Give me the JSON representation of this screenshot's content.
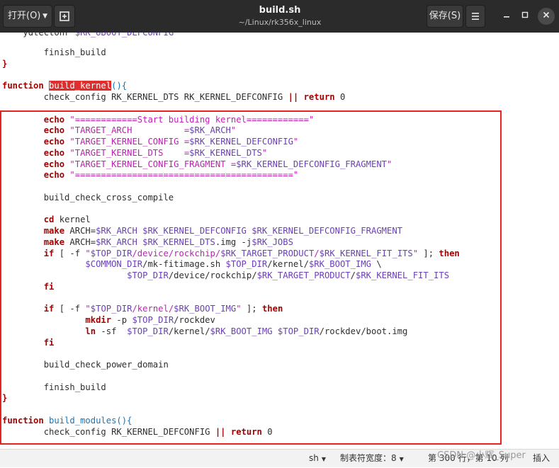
{
  "header": {
    "open_label": "打开(O)",
    "title": "build.sh",
    "subtitle": "~/Linux/rk356x_linux",
    "save_label": "保存(S)"
  },
  "code_lines": [
    [
      {
        "t": "        finish_build",
        "c": ""
      }
    ],
    [
      {
        "t": "}",
        "c": "kw"
      }
    ],
    [],
    [
      {
        "t": "function",
        "c": "kw"
      },
      {
        "t": " ",
        "c": ""
      },
      {
        "t": "build_kernel",
        "c": "hl"
      },
      {
        "t": "(){",
        "c": "fn"
      }
    ],
    [
      {
        "t": "        check_config RK_KERNEL_DTS RK_KERNEL_DEFCONFIG ",
        "c": ""
      },
      {
        "t": "||",
        "c": "kw"
      },
      {
        "t": " ",
        "c": ""
      },
      {
        "t": "return",
        "c": "kw"
      },
      {
        "t": " 0",
        "c": ""
      }
    ],
    [],
    [
      {
        "t": "        ",
        "c": ""
      },
      {
        "t": "echo",
        "c": "kw"
      },
      {
        "t": " \"============Start building kernel============\"",
        "c": "st"
      }
    ],
    [
      {
        "t": "        ",
        "c": ""
      },
      {
        "t": "echo",
        "c": "kw"
      },
      {
        "t": " \"TARGET_ARCH          =",
        "c": "st"
      },
      {
        "t": "$RK_ARCH",
        "c": "vr"
      },
      {
        "t": "\"",
        "c": "st"
      }
    ],
    [
      {
        "t": "        ",
        "c": ""
      },
      {
        "t": "echo",
        "c": "kw"
      },
      {
        "t": " \"TARGET_KERNEL_CONFIG =",
        "c": "st"
      },
      {
        "t": "$RK_KERNEL_DEFCONFIG",
        "c": "vr"
      },
      {
        "t": "\"",
        "c": "st"
      }
    ],
    [
      {
        "t": "        ",
        "c": ""
      },
      {
        "t": "echo",
        "c": "kw"
      },
      {
        "t": " \"TARGET_KERNEL_DTS    =",
        "c": "st"
      },
      {
        "t": "$RK_KERNEL_DTS",
        "c": "vr"
      },
      {
        "t": "\"",
        "c": "st"
      }
    ],
    [
      {
        "t": "        ",
        "c": ""
      },
      {
        "t": "echo",
        "c": "kw"
      },
      {
        "t": " \"TARGET_KERNEL_CONFIG_FRAGMENT =",
        "c": "st"
      },
      {
        "t": "$RK_KERNEL_DEFCONFIG_FRAGMENT",
        "c": "vr"
      },
      {
        "t": "\"",
        "c": "st"
      }
    ],
    [
      {
        "t": "        ",
        "c": ""
      },
      {
        "t": "echo",
        "c": "kw"
      },
      {
        "t": " \"==========================================\"",
        "c": "st"
      }
    ],
    [],
    [
      {
        "t": "        build_check_cross_compile",
        "c": ""
      }
    ],
    [],
    [
      {
        "t": "        ",
        "c": ""
      },
      {
        "t": "cd",
        "c": "kw"
      },
      {
        "t": " kernel",
        "c": ""
      }
    ],
    [
      {
        "t": "        ",
        "c": ""
      },
      {
        "t": "make",
        "c": "kw"
      },
      {
        "t": " ARCH=",
        "c": ""
      },
      {
        "t": "$RK_ARCH $RK_KERNEL_DEFCONFIG $RK_KERNEL_DEFCONFIG_FRAGMENT",
        "c": "vr"
      }
    ],
    [
      {
        "t": "        ",
        "c": ""
      },
      {
        "t": "make",
        "c": "kw"
      },
      {
        "t": " ARCH=",
        "c": ""
      },
      {
        "t": "$RK_ARCH $RK_KERNEL_DTS",
        "c": "vr"
      },
      {
        "t": ".img -j",
        "c": ""
      },
      {
        "t": "$RK_JOBS",
        "c": "vr"
      }
    ],
    [
      {
        "t": "        ",
        "c": ""
      },
      {
        "t": "if",
        "c": "kw"
      },
      {
        "t": " [ -f ",
        "c": ""
      },
      {
        "t": "\"",
        "c": "st"
      },
      {
        "t": "$TOP_DIR",
        "c": "vr"
      },
      {
        "t": "/device/rockchip/",
        "c": "st"
      },
      {
        "t": "$RK_TARGET_PRODUCT",
        "c": "vr"
      },
      {
        "t": "/",
        "c": "st"
      },
      {
        "t": "$RK_KERNEL_FIT_ITS",
        "c": "vr"
      },
      {
        "t": "\"",
        "c": "st"
      },
      {
        "t": " ]; ",
        "c": ""
      },
      {
        "t": "then",
        "c": "kw"
      }
    ],
    [
      {
        "t": "                ",
        "c": ""
      },
      {
        "t": "$COMMON_DIR",
        "c": "vr"
      },
      {
        "t": "/mk-fitimage.sh ",
        "c": ""
      },
      {
        "t": "$TOP_DIR",
        "c": "vr"
      },
      {
        "t": "/kernel/",
        "c": ""
      },
      {
        "t": "$RK_BOOT_IMG",
        "c": "vr"
      },
      {
        "t": " \\",
        "c": ""
      }
    ],
    [
      {
        "t": "                        ",
        "c": ""
      },
      {
        "t": "$TOP_DIR",
        "c": "vr"
      },
      {
        "t": "/device/rockchip/",
        "c": ""
      },
      {
        "t": "$RK_TARGET_PRODUCT",
        "c": "vr"
      },
      {
        "t": "/",
        "c": ""
      },
      {
        "t": "$RK_KERNEL_FIT_ITS",
        "c": "vr"
      }
    ],
    [
      {
        "t": "        ",
        "c": ""
      },
      {
        "t": "fi",
        "c": "kw"
      }
    ],
    [],
    [
      {
        "t": "        ",
        "c": ""
      },
      {
        "t": "if",
        "c": "kw"
      },
      {
        "t": " [ -f ",
        "c": ""
      },
      {
        "t": "\"",
        "c": "st"
      },
      {
        "t": "$TOP_DIR",
        "c": "vr"
      },
      {
        "t": "/kernel/",
        "c": "st"
      },
      {
        "t": "$RK_BOOT_IMG",
        "c": "vr"
      },
      {
        "t": "\"",
        "c": "st"
      },
      {
        "t": " ]; ",
        "c": ""
      },
      {
        "t": "then",
        "c": "kw"
      }
    ],
    [
      {
        "t": "                ",
        "c": ""
      },
      {
        "t": "mkdir",
        "c": "kw"
      },
      {
        "t": " -p ",
        "c": ""
      },
      {
        "t": "$TOP_DIR",
        "c": "vr"
      },
      {
        "t": "/rockdev",
        "c": ""
      }
    ],
    [
      {
        "t": "                ",
        "c": ""
      },
      {
        "t": "ln",
        "c": "kw"
      },
      {
        "t": " -sf  ",
        "c": ""
      },
      {
        "t": "$TOP_DIR",
        "c": "vr"
      },
      {
        "t": "/kernel/",
        "c": ""
      },
      {
        "t": "$RK_BOOT_IMG $TOP_DIR",
        "c": "vr"
      },
      {
        "t": "/rockdev/boot.img",
        "c": ""
      }
    ],
    [
      {
        "t": "        ",
        "c": ""
      },
      {
        "t": "fi",
        "c": "kw"
      }
    ],
    [],
    [
      {
        "t": "        build_check_power_domain",
        "c": ""
      }
    ],
    [],
    [
      {
        "t": "        finish_build",
        "c": ""
      }
    ],
    [
      {
        "t": "}",
        "c": "kw"
      }
    ],
    [],
    [
      {
        "t": "function",
        "c": "kw"
      },
      {
        "t": " ",
        "c": ""
      },
      {
        "t": "build_modules(){",
        "c": "fn"
      }
    ],
    [
      {
        "t": "        check_config RK_KERNEL_DEFCONFIG ",
        "c": ""
      },
      {
        "t": "||",
        "c": "kw"
      },
      {
        "t": " ",
        "c": ""
      },
      {
        "t": "return",
        "c": "kw"
      },
      {
        "t": " 0",
        "c": ""
      }
    ]
  ],
  "statusbar": {
    "language": "sh",
    "tab_width": "制表符宽度：8",
    "position": "第 300 行，第 10 列",
    "mode": "插入"
  },
  "watermark": "CSDN @小辉_Super"
}
